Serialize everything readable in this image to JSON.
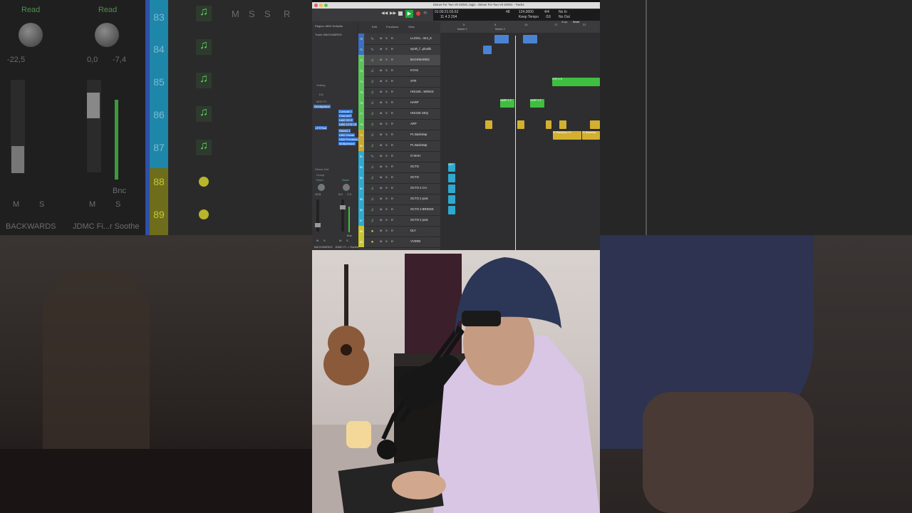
{
  "window": {
    "title": "Dinner For Two V6 SONG Jugio - Dinner For Two V6 SONG - Tracks"
  },
  "lcd": {
    "time": "01:00:21:03.62",
    "bars": "11  4  3  204",
    "tempo": "124,0000",
    "keep_tempo": "Keep Tempo",
    "signature": "4/4",
    "division": "/16",
    "midi_in": "No In",
    "midi_out": "No Out",
    "cycle_num": "48"
  },
  "toolbar": {
    "edit": "Edit",
    "functions": "Functions",
    "view": "View",
    "snap_label": "Snap:",
    "snap_value": "Smart"
  },
  "inspector": {
    "region": "Region: MIDI Defaults",
    "track": "Track: BACKWARDS",
    "setting_left": "Setting",
    "eq_left": "EQ",
    "midi_fx": "MIDI FX",
    "instrument": "Omnisphere",
    "lfo_tool": "LFOTool",
    "plugins": [
      "Console 1",
      "ChannelT",
      "UAD 3G E",
      "UAD 1176 LN",
      "Waves 1",
      "UAD Ocean",
      "UAD Precision",
      "Multipressor"
    ],
    "stereo_out": "Stereo Out",
    "group": "Group",
    "read_left": "Read",
    "read_right": "Read",
    "vol_left": "-22,5",
    "vol_right_a": "0,0",
    "vol_right_b": "-7,4",
    "bnc": "Bnc",
    "name_left": "BACKWARDS",
    "name_right": "JDMC Fi...r Soothe"
  },
  "ruler": {
    "markers": [
      "5",
      "9",
      "13",
      "17",
      "21"
    ],
    "marker1": "Marker 1",
    "marker2": "Marker 2"
  },
  "tracks": [
    {
      "num": "70",
      "name": "LLOOU...ntro_8",
      "type": "audio",
      "color": "#3c6fbf"
    },
    {
      "num": "71",
      "name": "synth_f...ploallo",
      "type": "audio",
      "color": "#3c6fbf"
    },
    {
      "num": "72",
      "name": "BACKWARDS",
      "type": "midi",
      "color": "#5cc35b",
      "selected": true
    },
    {
      "num": "73",
      "name": "KYAS",
      "type": "midi",
      "color": "#5cc35b"
    },
    {
      "num": "74",
      "name": "STR",
      "type": "midi",
      "color": "#5cc35b"
    },
    {
      "num": "75",
      "name": "HOUSE...WINGS",
      "type": "midi",
      "color": "#5cc35b"
    },
    {
      "num": "76",
      "name": "HARP",
      "type": "midi",
      "color": "#5cc35b"
    },
    {
      "num": "77",
      "name": "HOUSE SEQ",
      "type": "midi",
      "color": "#5cc35b"
    },
    {
      "num": "78",
      "name": "ARP",
      "type": "midi",
      "color": "#5cc35b"
    },
    {
      "num": "79",
      "name": "PL Backstop",
      "type": "midi",
      "color": "#c9a832"
    },
    {
      "num": "80",
      "name": "PL Backstop",
      "type": "midi",
      "color": "#c9a832"
    },
    {
      "num": "81",
      "name": "O WAH",
      "type": "audio",
      "color": "#2ea9d0"
    },
    {
      "num": "82",
      "name": "OCTO",
      "type": "midi",
      "color": "#2ea9d0"
    },
    {
      "num": "83",
      "name": "OCTO",
      "type": "midi",
      "color": "#2ea9d0"
    },
    {
      "num": "84",
      "name": "OCTO 2 CH",
      "type": "midi",
      "color": "#2ea9d0"
    },
    {
      "num": "85",
      "name": "OCTO 2 post",
      "type": "midi",
      "color": "#2ea9d0"
    },
    {
      "num": "86",
      "name": "OCTO 2 BRIDGE",
      "type": "midi",
      "color": "#2ea9d0"
    },
    {
      "num": "87",
      "name": "OCTO 2 post",
      "type": "midi",
      "color": "#2ea9d0"
    },
    {
      "num": "88",
      "name": "DLY",
      "type": "aux",
      "color": "#c9c632"
    },
    {
      "num": "89",
      "name": "VVERB",
      "type": "aux",
      "color": "#c9c632"
    }
  ],
  "track_buttons": {
    "mute": "M",
    "solo": "S",
    "rec": "R"
  },
  "regions": [
    {
      "label": "",
      "color": "#4a83d2"
    },
    {
      "label": "",
      "color": "#4a83d2"
    },
    {
      "label": "STR 1+5",
      "color": "#3fbf3f"
    },
    {
      "label": "HARP 1 9",
      "color": "#3fbf3f"
    },
    {
      "label": "HARP 1 9",
      "color": "#3fbf3f"
    },
    {
      "label": "PL Backstop 1 5",
      "color": "#d4b030"
    },
    {
      "label": "PL Backstop",
      "color": "#d4b030"
    },
    {
      "label": "OCT",
      "color": "#2ea9d0"
    }
  ],
  "side_left": {
    "read_a": "Read",
    "read_b": "Read",
    "vol_a": "-22,5",
    "vol_b": "0,0",
    "vol_c": "-7,4",
    "bnc": "Bnc",
    "m": "M",
    "s": "S",
    "name_a": "BACKWARDS",
    "name_b": "JDMC Fi...r Soothe",
    "numbers": [
      "83",
      "84",
      "85",
      "86",
      "87",
      "88",
      "89"
    ],
    "m_btn": "M",
    "s_btn": "S",
    "r_btn": "R"
  }
}
